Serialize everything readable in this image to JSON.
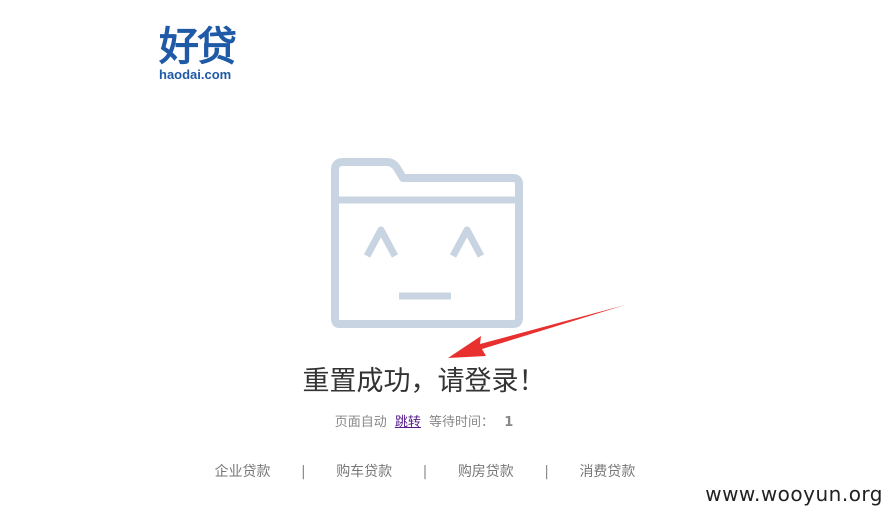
{
  "logo": {
    "name_cn": "好贷",
    "domain": "haodai.com",
    "brand_color": "#1f5aa6"
  },
  "illustration": {
    "icon": "sleepy-folder-icon",
    "color": "#c8d4e2"
  },
  "annotation": {
    "icon": "red-arrow-icon",
    "color": "#e8312f"
  },
  "message": {
    "headline": "重置成功，请登录！",
    "auto_prefix": "页面自动",
    "jump_link": "跳转",
    "wait_label": "等待时间：",
    "countdown": "1"
  },
  "footer": {
    "links": [
      "企业贷款",
      "购车贷款",
      "购房贷款",
      "消费贷款"
    ],
    "separator": "|"
  },
  "watermark": "www.wooyun.org"
}
